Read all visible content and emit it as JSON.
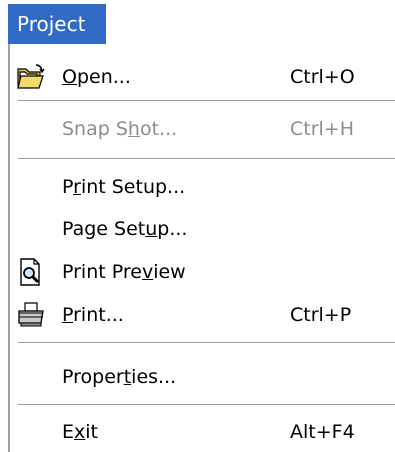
{
  "menubar": {
    "title": "Project"
  },
  "menu": {
    "open": {
      "label": "Open...",
      "shortcut": "Ctrl+O",
      "icon": "open-folder-icon"
    },
    "snapshot": {
      "label": "Snap Shot...",
      "shortcut": "Ctrl+H"
    },
    "print_setup": {
      "label": "Print Setup..."
    },
    "page_setup": {
      "label": "Page Setup..."
    },
    "print_preview": {
      "label": "Print Preview",
      "icon": "print-preview-icon"
    },
    "print": {
      "label": "Print...",
      "shortcut": "Ctrl+P",
      "icon": "printer-icon"
    },
    "properties": {
      "label": "Properties..."
    },
    "exit": {
      "label": "Exit",
      "shortcut": "Alt+F4"
    }
  },
  "colors": {
    "highlight": "#316ac5",
    "disabled_text": "#8c8c8c",
    "separator": "#a0a0a0"
  }
}
